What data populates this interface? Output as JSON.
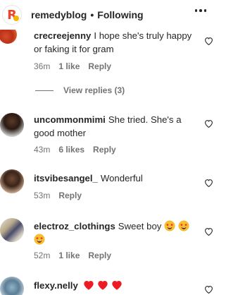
{
  "header": {
    "username": "remedyblog",
    "separator": "•",
    "follow_status": "Following",
    "logo_letter": "R",
    "more_icon": "more-horizontal-icon"
  },
  "comments": [
    {
      "username": "crecreejenny",
      "text": "I hope she's truly happy or faking it for gram",
      "time": "36m",
      "likes": "1 like",
      "reply": "Reply"
    },
    {
      "username": "uncommonmimi",
      "text": "She tried. She's a good mother",
      "time": "43m",
      "likes": "6 likes",
      "reply": "Reply"
    },
    {
      "username": "itsvibesangel_",
      "text": "Wonderful",
      "time": "53m",
      "reply": "Reply"
    },
    {
      "username": "electroz_clothings",
      "text": "Sweet boy",
      "emojis": [
        "star-struck-emoji",
        "star-struck-emoji",
        "star-struck-emoji"
      ],
      "time": "52m",
      "likes": "1 like",
      "reply": "Reply"
    },
    {
      "username": "flexy.nelly",
      "emojis": [
        "red-heart-emoji",
        "red-heart-emoji",
        "red-heart-emoji"
      ]
    }
  ],
  "view_replies": "View replies (3)",
  "colors": {
    "text": "#262626",
    "secondary": "#737373",
    "brand_red": "#e8472f",
    "heart_red": "#ed1c24"
  }
}
